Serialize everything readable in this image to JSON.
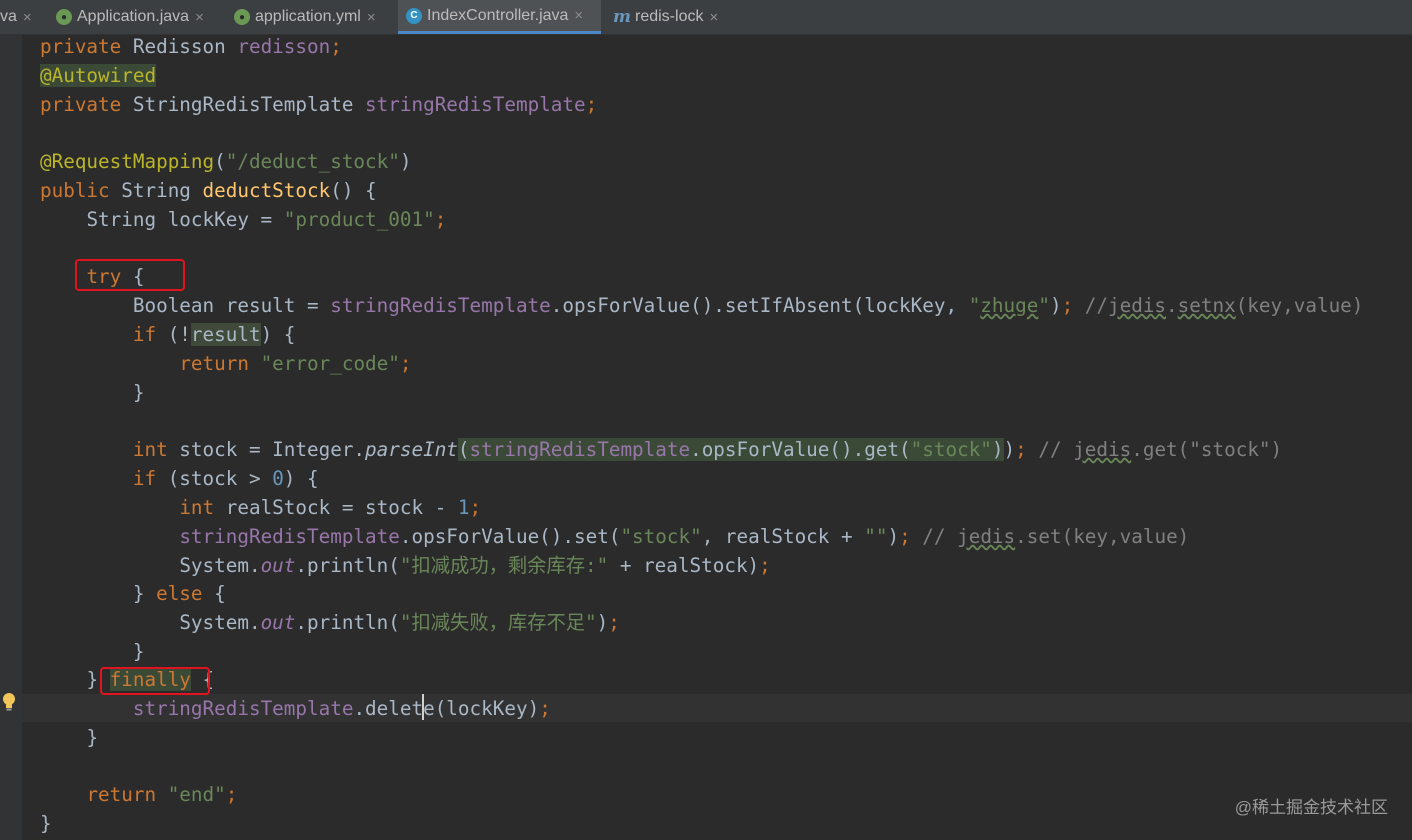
{
  "tabs": [
    {
      "label": "va",
      "icon": "none"
    },
    {
      "label": "Application.java",
      "icon": "spring-class-icon"
    },
    {
      "label": "application.yml",
      "icon": "spring-config-icon"
    },
    {
      "label": "IndexController.java",
      "icon": "class-icon",
      "active": true
    },
    {
      "label": "redis-lock",
      "icon": "module-icon"
    }
  ],
  "close_glyph": "×",
  "code": {
    "l1": [
      "private",
      " Redisson ",
      "redisson",
      ";"
    ],
    "l2": [
      "@Autowired"
    ],
    "l3": [
      "private",
      " StringRedisTemplate ",
      "stringRedisTemplate",
      ";"
    ],
    "l5": [
      "@RequestMapping",
      "(",
      "\"/deduct_stock\"",
      ")"
    ],
    "l6": [
      "public",
      " String ",
      "deductStock",
      "() {"
    ],
    "l7": [
      "String lockKey = ",
      "\"product_001\"",
      ";"
    ],
    "l9": [
      "try",
      " {"
    ],
    "l10": [
      "Boolean result = ",
      "stringRedisTemplate",
      ".opsForValue().setIfAbsent(lockKey, ",
      "\"",
      "zhuge",
      "\"",
      ")",
      ";",
      " //",
      "jedis",
      ".",
      "setnx",
      "(key,value)"
    ],
    "l11": [
      "if",
      " (!",
      "result",
      ") {"
    ],
    "l12": [
      "return",
      " ",
      "\"error_code\"",
      ";"
    ],
    "l13": [
      "}"
    ],
    "l15": [
      "int",
      " stock = Integer.",
      "parseInt",
      "(",
      "stringRedisTemplate",
      ".opsForValue().get(",
      "\"stock\"",
      ")",
      ")",
      ";",
      " // ",
      "jedis",
      ".get(\"stock\")"
    ],
    "l16": [
      "if",
      " (stock > ",
      "0",
      ") {"
    ],
    "l17": [
      "int",
      " realStock = stock - ",
      "1",
      ";"
    ],
    "l18": [
      "stringRedisTemplate",
      ".opsForValue().set(",
      "\"stock\"",
      ", realStock + ",
      "\"\"",
      ")",
      ";",
      " // ",
      "jedis",
      ".set(key,value)"
    ],
    "l19": [
      "System.",
      "out",
      ".println(",
      "\"扣减成功，剩余库存:\"",
      " + realStock)",
      ";"
    ],
    "l20": [
      "} ",
      "else",
      " {"
    ],
    "l21": [
      "System.",
      "out",
      ".println(",
      "\"扣减失败，库存不足\"",
      ")",
      ";"
    ],
    "l22": [
      "}"
    ],
    "l23": [
      "} ",
      "finally",
      " {"
    ],
    "l24": [
      "stringRedisTemplate",
      ".dele",
      "te(lockKey)",
      ";"
    ],
    "l25": [
      "}"
    ],
    "l27": [
      "return",
      " ",
      "\"end\"",
      ";"
    ],
    "l28": [
      "}"
    ]
  },
  "watermark": "@稀土掘金技术社区",
  "colors": {
    "keyword": "#cc7832",
    "annotation": "#bbb529",
    "string": "#6a8759",
    "field": "#9876aa",
    "comment": "#808080",
    "number": "#6897bb",
    "highlight_box": "#e0141e",
    "active_tab_underline": "#4a88c7"
  }
}
